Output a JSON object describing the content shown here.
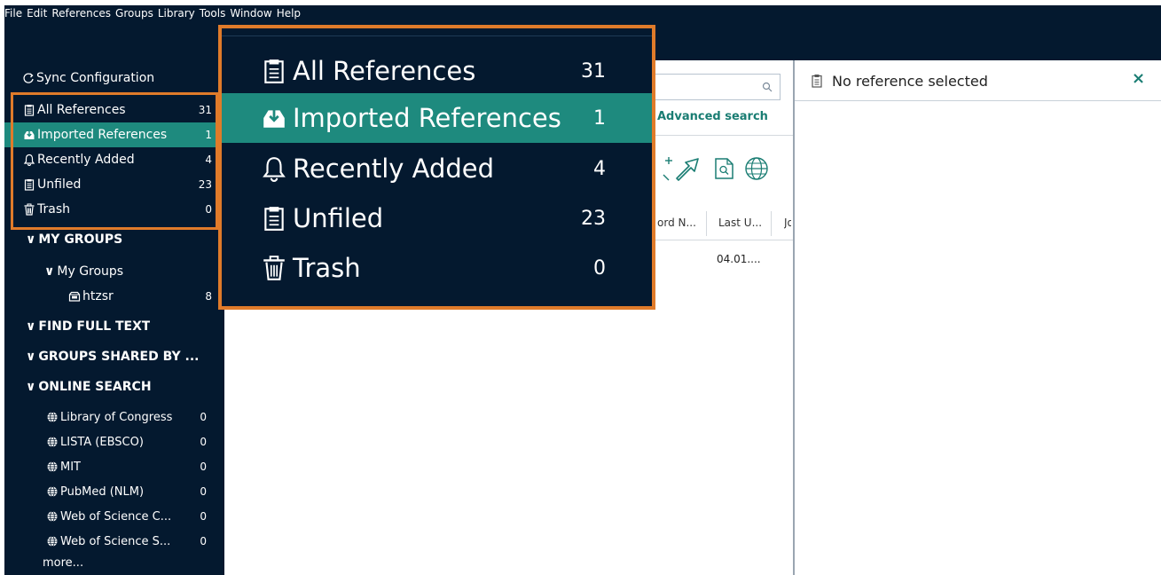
{
  "menu": [
    "File",
    "Edit",
    "References",
    "Groups",
    "Library",
    "Tools",
    "Window",
    "Help"
  ],
  "sidebar": {
    "sync": "Sync Configuration",
    "library": [
      {
        "label": "All References",
        "count": "31",
        "icon": "clipboard-icon"
      },
      {
        "label": "Imported References",
        "count": "1",
        "icon": "import-icon"
      },
      {
        "label": "Recently Added",
        "count": "4",
        "icon": "bell-icon"
      },
      {
        "label": "Unfiled",
        "count": "23",
        "icon": "clipboard-icon"
      },
      {
        "label": "Trash",
        "count": "0",
        "icon": "trash-icon"
      }
    ],
    "my_groups_header": "MY GROUPS",
    "my_groups_sub": "My Groups",
    "group_item": {
      "label": "htzsr",
      "count": "8"
    },
    "find_full_text": "FIND FULL TEXT",
    "groups_shared": "GROUPS SHARED BY ...",
    "online_search": "ONLINE SEARCH",
    "online_items": [
      {
        "label": "Library of Congress",
        "count": "0"
      },
      {
        "label": "LISTA (EBSCO)",
        "count": "0"
      },
      {
        "label": "MIT",
        "count": "0"
      },
      {
        "label": "PubMed (NLM)",
        "count": "0"
      },
      {
        "label": "Web of Science C...",
        "count": "0"
      },
      {
        "label": "Web of Science S...",
        "count": "0"
      }
    ],
    "more": "more..."
  },
  "popup": [
    {
      "label": "All References",
      "count": "31"
    },
    {
      "label": "Imported References",
      "count": "1"
    },
    {
      "label": "Recently Added",
      "count": "4"
    },
    {
      "label": "Unfiled",
      "count": "23"
    },
    {
      "label": "Trash",
      "count": "0"
    }
  ],
  "middle": {
    "advanced_search": "Advanced search",
    "columns": [
      "ord N...",
      "Last U...",
      "Jo"
    ],
    "cell_last_updated": "04.01...."
  },
  "right": {
    "title": "No reference selected",
    "close": "×"
  },
  "colors": {
    "navy": "#04192f",
    "teal": "#1e8a7e",
    "orange": "#e07b2a"
  }
}
